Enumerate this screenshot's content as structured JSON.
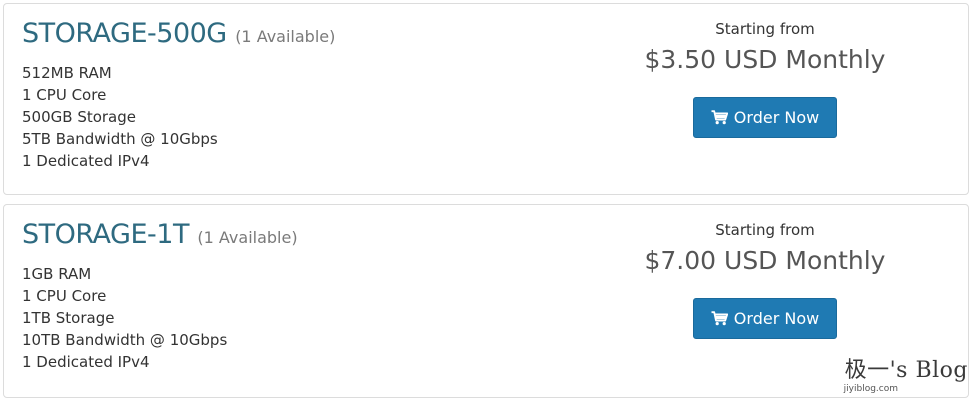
{
  "products": [
    {
      "name": "STORAGE-500G",
      "availability": "(1 Available)",
      "features": [
        "512MB RAM",
        "1 CPU Core",
        "500GB Storage",
        "5TB Bandwidth @ 10Gbps",
        "1 Dedicated IPv4"
      ],
      "starting_label": "Starting from",
      "price": "$3.50 USD Monthly",
      "order_label": "Order Now"
    },
    {
      "name": "STORAGE-1T",
      "availability": "(1 Available)",
      "features": [
        "1GB RAM",
        "1 CPU Core",
        "1TB Storage",
        "10TB Bandwidth @ 10Gbps",
        "1 Dedicated IPv4"
      ],
      "starting_label": "Starting from",
      "price": "$7.00 USD Monthly",
      "order_label": "Order Now"
    }
  ],
  "watermark": {
    "main": "极一's Blog",
    "sub": "jiyiblog.com"
  },
  "colors": {
    "title": "#2e6a80",
    "button": "#1f7ab3"
  },
  "icons": {
    "order_button": "shopping-cart-icon"
  }
}
